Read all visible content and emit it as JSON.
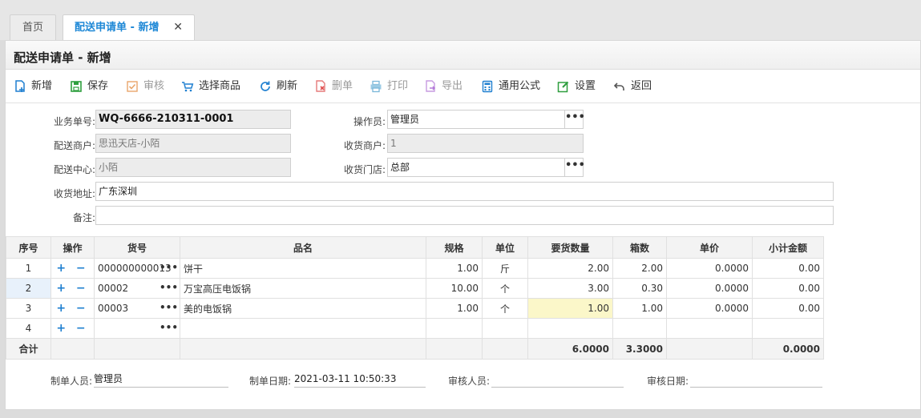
{
  "tabs": [
    {
      "label": "首页"
    },
    {
      "label": "配送申请单 - 新增",
      "close": "✕"
    }
  ],
  "page_title": "配送申请单 - 新增",
  "toolbar": {
    "add": "新增",
    "save": "保存",
    "audit": "审核",
    "select_goods": "选择商品",
    "refresh": "刷新",
    "delete": "删单",
    "print": "打印",
    "export": "导出",
    "formula": "通用公式",
    "settings": "设置",
    "back": "返回"
  },
  "form": {
    "order_no_label": "业务单号:",
    "order_no": "WQ-6666-210311-0001",
    "operator_label": "操作员:",
    "operator": "管理员",
    "dist_merchant_label": "配送商户:",
    "dist_merchant": "思迅天店-小陌",
    "recv_merchant_label": "收货商户:",
    "recv_merchant": "1",
    "dist_center_label": "配送中心:",
    "dist_center": "小陌",
    "recv_store_label": "收货门店:",
    "recv_store": "总部",
    "address_label": "收货地址:",
    "address": "广东深圳",
    "remark_label": "备注:",
    "remark": "",
    "more": "•••"
  },
  "grid": {
    "headers": [
      "序号",
      "操作",
      "货号",
      "品名",
      "规格",
      "单位",
      "要货数量",
      "箱数",
      "单价",
      "小计金额"
    ],
    "ops": "+ −",
    "goods_more": "•••",
    "rows": [
      {
        "idx": "1",
        "code": "000000000013",
        "name": "饼干",
        "spec": "1.00",
        "unit": "斤",
        "qty": "2.00",
        "boxes": "2.00",
        "price": "0.0000",
        "subtotal": "0.00"
      },
      {
        "idx": "2",
        "code": "00002",
        "name": "万宝高压电饭锅",
        "spec": "10.00",
        "unit": "个",
        "qty": "3.00",
        "boxes": "0.30",
        "price": "0.0000",
        "subtotal": "0.00"
      },
      {
        "idx": "3",
        "code": "00003",
        "name": "美的电饭锅",
        "spec": "1.00",
        "unit": "个",
        "qty": "1.00",
        "boxes": "1.00",
        "price": "0.0000",
        "subtotal": "0.00"
      },
      {
        "idx": "4",
        "code": "",
        "name": "",
        "spec": "",
        "unit": "",
        "qty": "",
        "boxes": "",
        "price": "",
        "subtotal": ""
      }
    ],
    "total": {
      "label": "合计",
      "qty": "6.0000",
      "boxes": "3.3000",
      "subtotal": "0.0000"
    }
  },
  "footer": {
    "maker_label": "制单人员:",
    "maker": "管理员",
    "make_date_label": "制单日期:",
    "make_date": "2021-03-11 10:50:33",
    "auditor_label": "审核人员:",
    "auditor": "",
    "audit_date_label": "审核日期:",
    "audit_date": ""
  },
  "colors": {
    "accent": "#1e88d6",
    "highlight": "#fbf7c9"
  }
}
